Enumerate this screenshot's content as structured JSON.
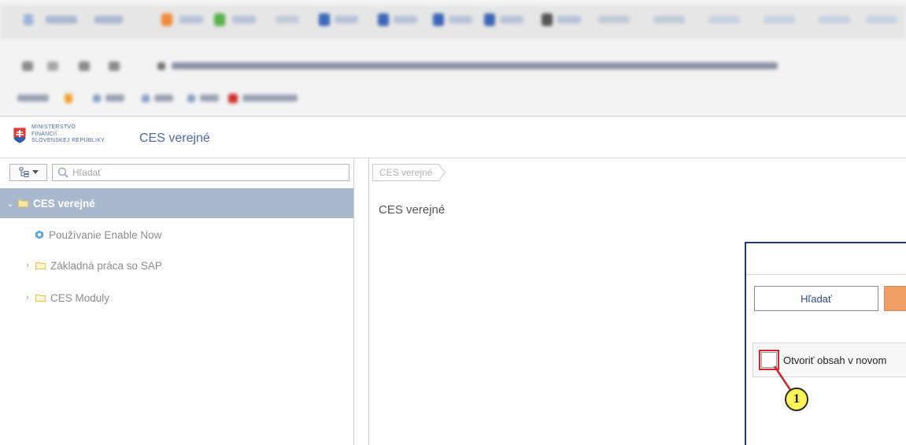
{
  "app": {
    "logo_lines": [
      "MINISTERSTVO",
      "FINANCIÍ",
      "SLOVENSKEJ REPUBLIKY"
    ],
    "title": "CES verejné"
  },
  "nav": {
    "search_placeholder": "Hľadať",
    "items": [
      {
        "label": "CES verejné",
        "selected": true,
        "expanded": true,
        "icon": "folder-icon"
      },
      {
        "label": "Používanie Enable Now",
        "selected": false,
        "icon": "enable-now-icon"
      },
      {
        "label": "Základná práca so SAP",
        "selected": false,
        "expanded": false,
        "icon": "folder-icon"
      },
      {
        "label": "CES Moduly",
        "selected": false,
        "expanded": false,
        "icon": "folder-icon"
      }
    ]
  },
  "main": {
    "breadcrumb": [
      "CES verejné"
    ],
    "page_title": "CES verejné"
  },
  "dialog": {
    "search_button": "Hľadať",
    "option_label": "Otvoriť obsah v novom",
    "option_checked": false
  },
  "annotation": {
    "step_number": "1"
  },
  "colors": {
    "selected_row": "#a9b8cd",
    "brand_blue": "#4d6b9e",
    "dialog_border": "#203a6e",
    "accent_orange": "#f0a065",
    "highlight_red": "#d0262c",
    "marker_yellow": "#fff35a"
  }
}
